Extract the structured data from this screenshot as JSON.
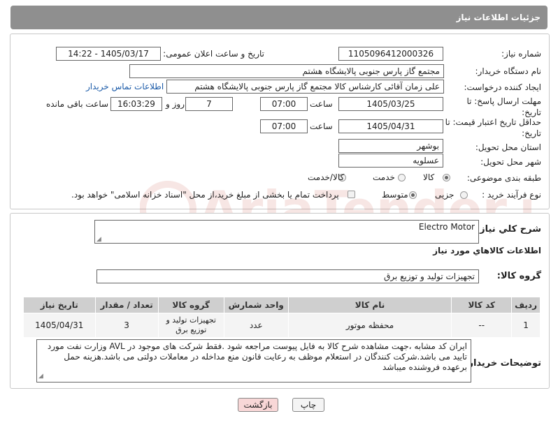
{
  "header": {
    "title": "جزئیات اطلاعات نیاز"
  },
  "form": {
    "need_number": {
      "label": "شماره نیاز:",
      "value": "1105096412000326"
    },
    "announce": {
      "label": "تاریخ و ساعت اعلان عمومی:",
      "value": "1405/03/17 - 14:22"
    },
    "buyer": {
      "label": "نام دستگاه خریدار:",
      "value": "مجتمع گاز پارس جنوبی  پالایشگاه هشتم"
    },
    "creator": {
      "label": "ایجاد کننده درخواست:",
      "value": "علی زمان آقائی کارشناس کالا مجتمع گاز پارس جنوبی  پالایشگاه هشتم",
      "contact_link": "اطلاعات تماس خریدار"
    },
    "deadline": {
      "label": "مهلت ارسال پاسخ: تا تاریخ:",
      "date": "1405/03/25",
      "time_label": "ساعت",
      "time": "07:00",
      "days": "7",
      "days_label": "روز و",
      "remaining": "16:03:29",
      "remaining_label": "ساعت باقی مانده"
    },
    "validity": {
      "label": "حداقل تاریخ اعتبار قیمت: تا تاریخ:",
      "date": "1405/04/31",
      "time_label": "ساعت",
      "time": "07:00"
    },
    "province": {
      "label": "استان محل تحویل:",
      "value": "بوشهر"
    },
    "city": {
      "label": "شهر محل تحویل:",
      "value": "عسلویه"
    },
    "category": {
      "label": "طبقه بندی موضوعی:",
      "options": [
        "کالا",
        "خدمت",
        "کالا/خدمت"
      ],
      "selected": "کالا"
    },
    "purchase_type": {
      "label": "نوع فرآیند خرید :",
      "options": [
        "جزیی",
        "متوسط"
      ],
      "selected": "متوسط",
      "payment_note": "پرداخت تمام یا بخشی از مبلغ خرید،از محل \"اسناد خزانه اسلامی\" خواهد بود."
    }
  },
  "details": {
    "summary_label": "شرح کلي نياز:",
    "summary_value": "Electro Motor",
    "goods_info_title": "اطلاعات کالاهاي مورد نياز",
    "group_label": "گروه کالا:",
    "group_value": "تجهیزات تولید و توزیع برق",
    "table": {
      "headers": [
        "ردیف",
        "کد کالا",
        "نام کالا",
        "واحد شمارش",
        "گروه کالا",
        "تعداد / مقدار",
        "تاریخ نیاز"
      ],
      "rows": [
        [
          "1",
          "--",
          "محفظه موتور",
          "عدد",
          "تجهیزات تولید و توزیع برق",
          "3",
          "1405/04/31"
        ]
      ]
    },
    "buyer_notes_label": "توضیحات خریدار:",
    "buyer_notes": "ایران کد مشابه ،جهت مشاهده شرح کالا به فایل پیوست مراجعه شود .فقط شرکت های موجود در AVL وزارت نفت مورد تایید می باشد.شرکت کنندگان در استعلام موظف به رعایت قانون منع مداخله در معاملات دولتی می باشد.هزینه حمل برعهده فروشنده میباشد"
  },
  "buttons": {
    "print": "چاپ",
    "back": "بازگشت"
  },
  "watermark": {
    "text": "AriaTender.net"
  },
  "colors": {
    "header_bg": "#8f8f8f",
    "link": "#1a5aa8",
    "table_header": "#cfcfcf",
    "back_button": "#f8d7d7"
  }
}
